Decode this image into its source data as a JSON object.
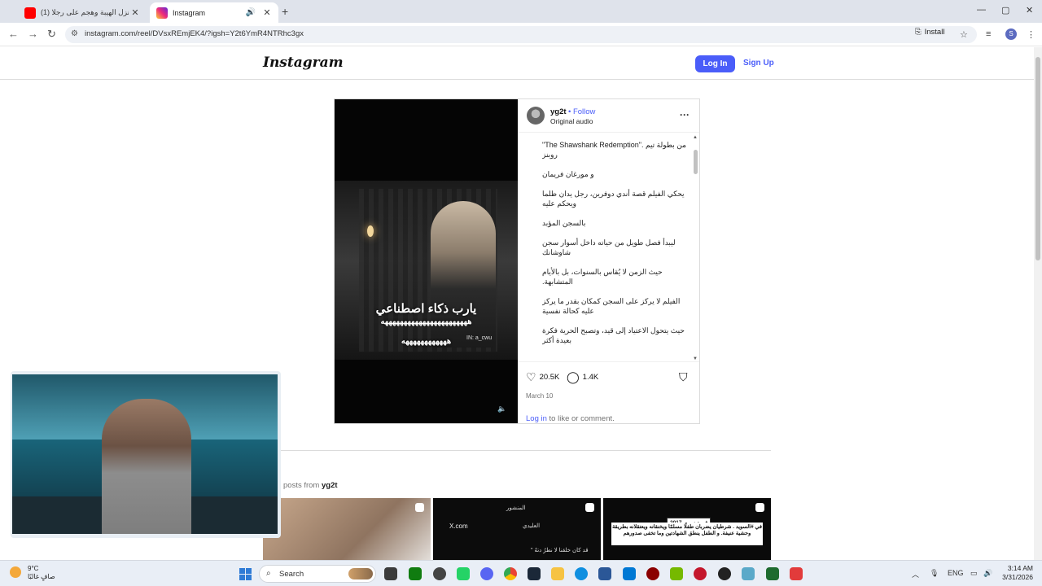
{
  "browser": {
    "tabs": [
      {
        "title": "(1) جبل نزل الهيبة وهجم على رجلا",
        "favicon_color": "#ff0000"
      },
      {
        "title": "Instagram",
        "favicon_color": "#d6249f"
      }
    ],
    "new_tab_symbol": "+",
    "url": "instagram.com/reel/DVsxREmjEK4/?igsh=Y2t6YmR4NTRhc3gx",
    "install_label": "Install",
    "profile_initial": "S"
  },
  "instagram": {
    "logo": "Instagram",
    "login_label": "Log In",
    "signup_label": "Sign Up",
    "post": {
      "username": "yg2t",
      "follow_label": "Follow",
      "audio": "Original audio",
      "video_overlay": {
        "watermark": "IN: a_cwu",
        "line1": "يارب ذكاء اصطناعي",
        "line2": "هههههههههههههههههههههههه",
        "line3": "ههههههههههههه"
      },
      "caption": [
        "\"The Shawshank Redemption\". من بطولة تيم روبنز",
        "و مورغان فريمان",
        "يحكي الفيلم قصة أندي دوفرين، رجل يدان ظلما ويحكم عليه",
        "بالسجن المؤبد",
        "ليبدأ فصل طويل من حياته داخل أسوار سجن شاوشانك",
        "حيث الزمن لا يُقاس بالسنوات، بل بالأيام المتشابهة.",
        "الفيلم لا يركز على السجن كمكان بقدر ما يركز عليه كحالة نفسية",
        "حيث يتحول الاعتياد إلى قيد، وتصبح الحرية فكرة بعيدة أكثر"
      ],
      "likes": "20.5K",
      "comments": "1.4K",
      "date": "March 10",
      "login_link": "Log in",
      "comment_prompt": " to like or comment."
    },
    "more_posts": {
      "prefix": "posts from ",
      "username": "yg2t",
      "thumb2": {
        "title": "المنشور",
        "site": "X.com",
        "handle": "العليدي",
        "quote": "\" قد كان خلقنا لا نطرُ دتهُ"
      },
      "thumb3": {
        "date": "في ديسمبر 2017",
        "text": "في #السويد . شرطيان يضربان طفلًا مسلمًا ويخنقانه ويعتقلانه بطريقة وحشية عنيفة. و الطفل ينطق الشهادتين وما تخفى صدورهم"
      }
    }
  },
  "taskbar": {
    "temperature": "9°C",
    "condition": "صافٍ غالبًا",
    "search_label": "Search",
    "language": "ENG",
    "time": "3:14 AM",
    "date": "3/31/2026"
  }
}
